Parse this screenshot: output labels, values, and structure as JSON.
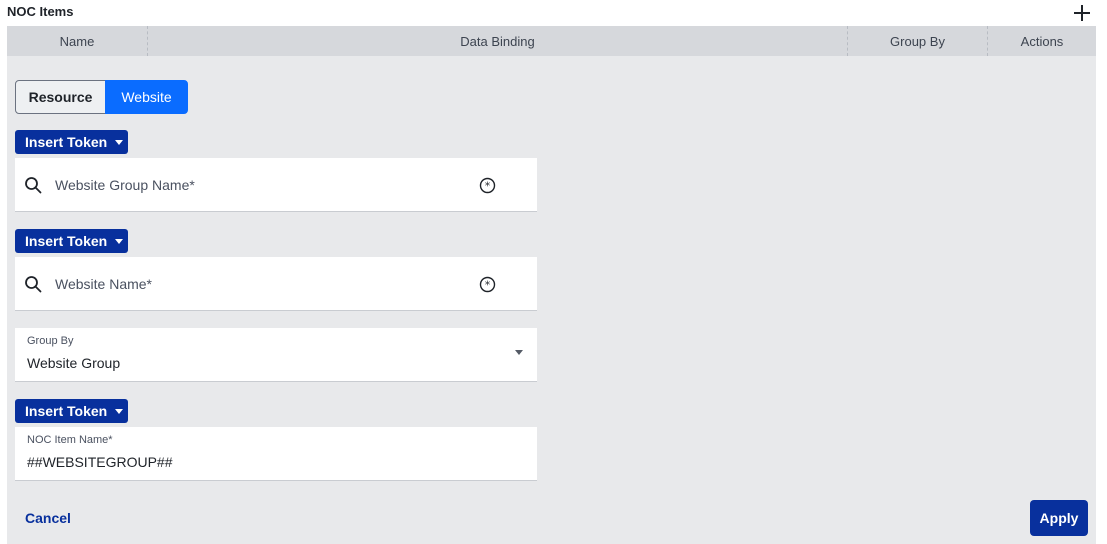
{
  "header": {
    "title": "NOC Items",
    "add_icon": "plus-icon"
  },
  "table": {
    "columns": [
      "Name",
      "Data Binding",
      "Group By",
      "Actions"
    ]
  },
  "form": {
    "tabs": [
      {
        "label": "Resource",
        "selected": false
      },
      {
        "label": "Website",
        "selected": true
      }
    ],
    "insert_token_label": "Insert Token",
    "website_group_field": {
      "placeholder": "Website Group Name*",
      "icon": "search-icon",
      "clear_icon": "asterisk-circle-icon"
    },
    "website_name_field": {
      "placeholder": "Website Name*",
      "icon": "search-icon",
      "clear_icon": "asterisk-circle-icon"
    },
    "group_by": {
      "label": "Group By",
      "value": "Website Group"
    },
    "noc_item_name": {
      "label": "NOC Item Name*",
      "value": "##WEBSITEGROUP##"
    },
    "cancel_label": "Cancel",
    "apply_label": "Apply"
  },
  "colors": {
    "accent": "#0a6cff",
    "primary_dark": "#08309d",
    "header_bg": "#d6d8dc",
    "panel_bg": "#e8e9eb"
  }
}
